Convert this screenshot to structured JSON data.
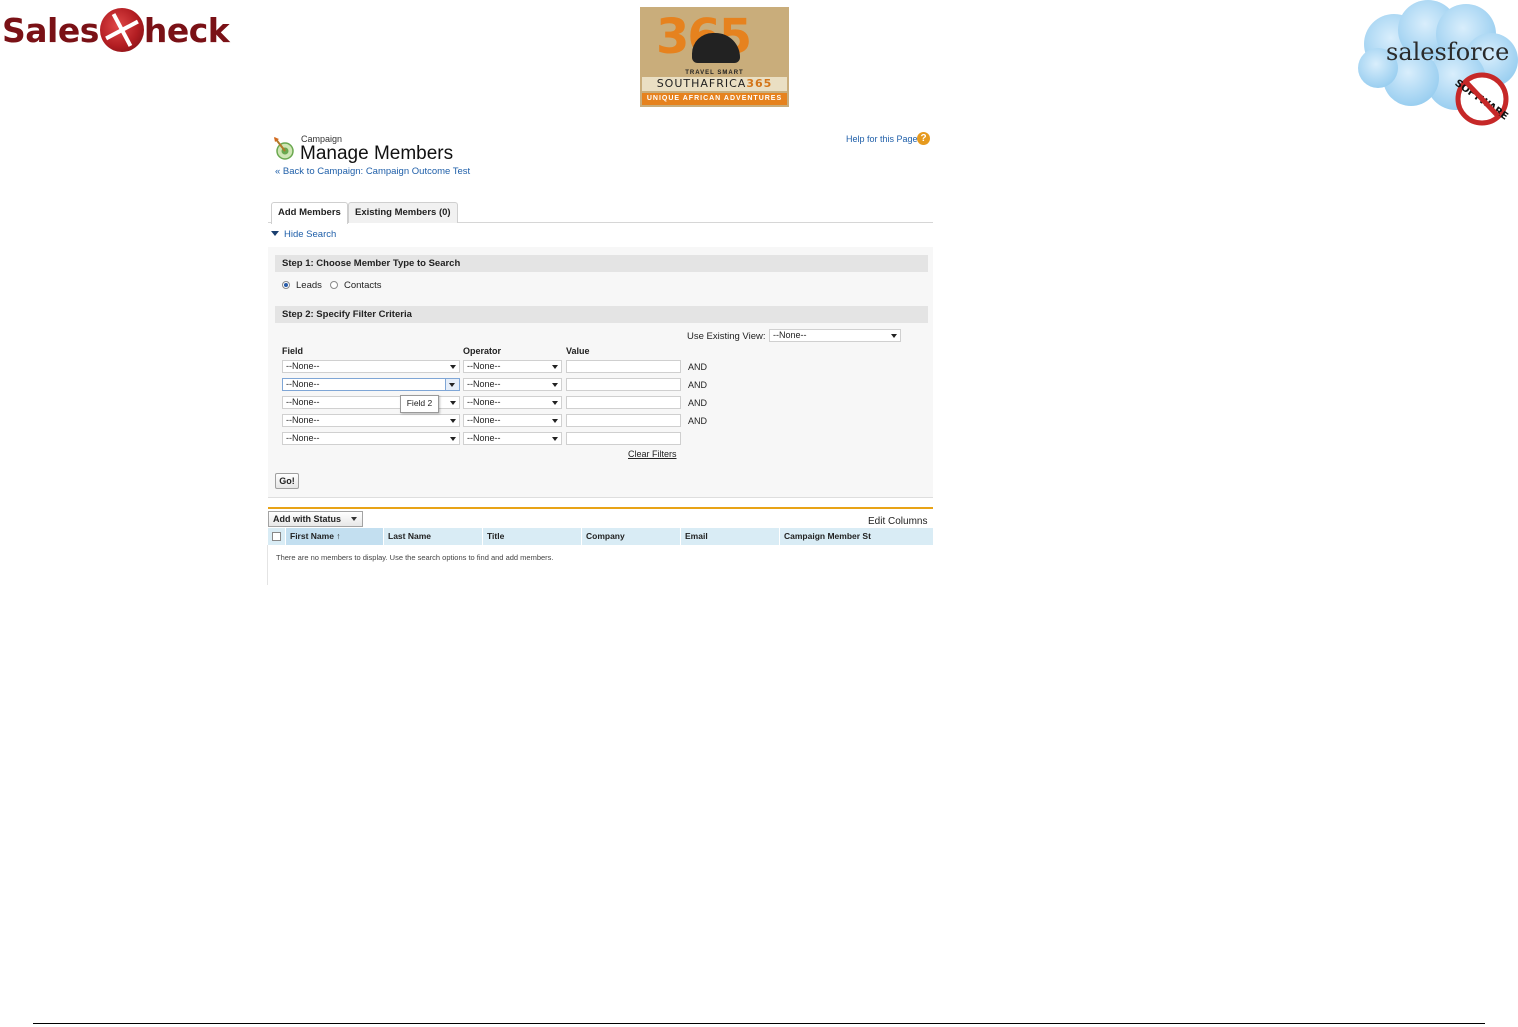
{
  "logos": {
    "salescheck": {
      "part1": "Sales",
      "part2": "heck"
    },
    "southafrica365": {
      "number": "365",
      "tagline": "TRAVEL SMART",
      "name_a": "SOUTHAFRICA",
      "name_b": "365",
      "slogan": "UNIQUE AFRICAN ADVENTURES"
    },
    "salesforce": {
      "word": "salesforce",
      "stamp": "SOFTWARE"
    }
  },
  "header": {
    "breadcrumb": "Campaign",
    "title": "Manage Members",
    "back_link": "« Back to Campaign: Campaign Outcome Test",
    "help_link": "Help for this Page",
    "help_icon": "?"
  },
  "tabs": [
    {
      "label": "Add Members",
      "active": true
    },
    {
      "label": "Existing Members (0)",
      "active": false
    }
  ],
  "search": {
    "hide_label": "Hide Search",
    "step1": {
      "title": "Step 1: Choose Member Type to Search",
      "options": [
        {
          "label": "Leads",
          "selected": true
        },
        {
          "label": "Contacts",
          "selected": false
        }
      ]
    },
    "step2": {
      "title": "Step 2: Specify Filter Criteria",
      "existing_view_label": "Use Existing View:",
      "existing_view_value": "--None--",
      "columns": {
        "field": "Field",
        "operator": "Operator",
        "value": "Value"
      },
      "rows": [
        {
          "field": "--None--",
          "operator": "--None--",
          "value": "",
          "conj": "AND"
        },
        {
          "field": "--None--",
          "operator": "--None--",
          "value": "",
          "conj": "AND"
        },
        {
          "field": "--None--",
          "operator": "--None--",
          "value": "",
          "conj": "AND"
        },
        {
          "field": "--None--",
          "operator": "--None--",
          "value": "",
          "conj": "AND"
        },
        {
          "field": "--None--",
          "operator": "--None--",
          "value": "",
          "conj": ""
        }
      ],
      "tooltip": "Field 2",
      "clear_filters": "Clear Filters"
    },
    "go_button": "Go!"
  },
  "results": {
    "add_with_status": "Add with Status",
    "edit_columns": "Edit Columns",
    "columns": [
      "First Name ↑",
      "Last Name",
      "Title",
      "Company",
      "Email",
      "Campaign Member St"
    ],
    "empty_message": "There are no members to display. Use the search options to find and add members."
  }
}
